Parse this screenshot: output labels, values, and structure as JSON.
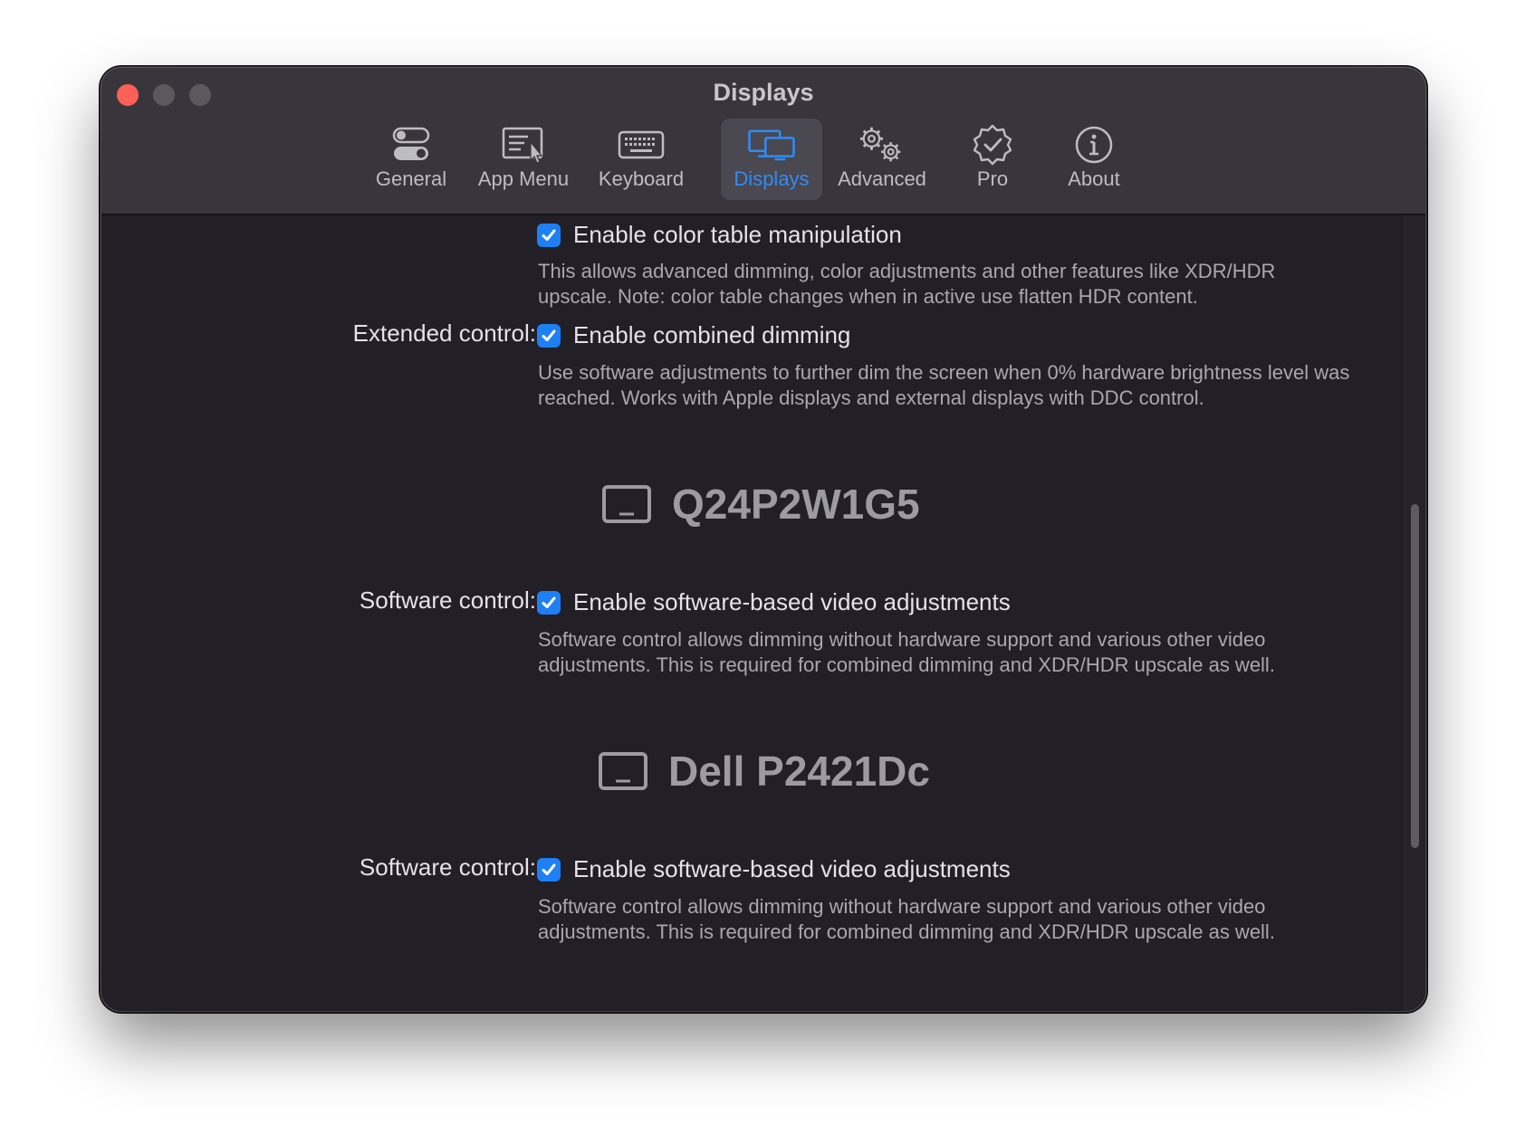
{
  "window": {
    "title": "Displays"
  },
  "toolbar": {
    "tabs": [
      {
        "label": "General",
        "icon": "toggles-icon"
      },
      {
        "label": "App Menu",
        "icon": "app-menu-icon"
      },
      {
        "label": "Keyboard",
        "icon": "keyboard-icon"
      },
      {
        "label": "Displays",
        "icon": "displays-icon",
        "active": true
      },
      {
        "label": "Advanced",
        "icon": "gears-icon"
      },
      {
        "label": "Pro",
        "icon": "verified-badge-icon"
      },
      {
        "label": "About",
        "icon": "info-icon"
      }
    ]
  },
  "colors": {
    "accent": "#1f7ff4",
    "active_tab_text": "#2f8cf6",
    "close": "#fe5f57"
  },
  "settings": {
    "color_table": {
      "label": "Enable color table manipulation",
      "checked": true,
      "description": "This allows advanced dimming, color adjustments and other features like XDR/HDR upscale. Note: color table changes when in active use flatten HDR content."
    },
    "extended_control": {
      "row_label": "Extended control:",
      "label": "Enable combined dimming",
      "checked": true,
      "description": "Use software adjustments to further dim the screen when 0% hardware brightness level was reached. Works with Apple displays and external displays with DDC control."
    }
  },
  "displays": [
    {
      "name": "Q24P2W1G5",
      "icon": "monitor-icon",
      "row_label": "Software control:",
      "label": "Enable software-based video adjustments",
      "checked": true,
      "description": "Software control allows dimming without hardware support and  various other video adjustments. This is required for combined dimming and XDR/HDR upscale as well."
    },
    {
      "name": "Dell P2421Dc",
      "icon": "monitor-icon",
      "row_label": "Software control:",
      "label": "Enable software-based video adjustments",
      "checked": true,
      "description": "Software control allows dimming without hardware support and  various other video adjustments. This is required for combined dimming and XDR/HDR upscale as well."
    }
  ]
}
